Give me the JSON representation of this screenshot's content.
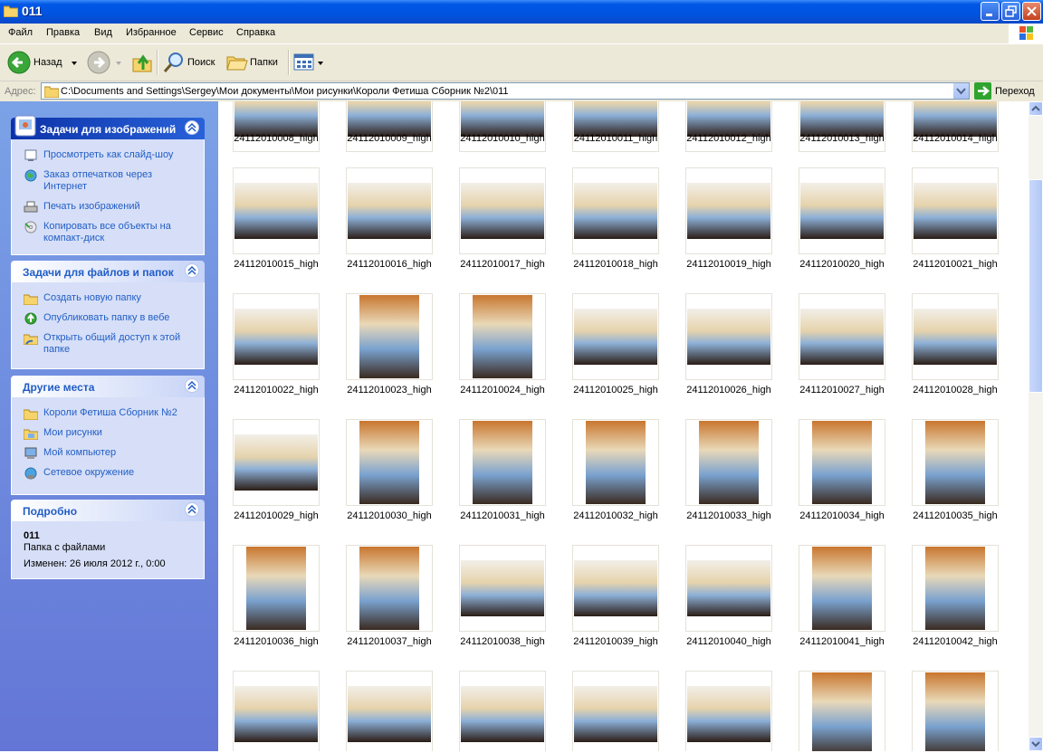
{
  "window": {
    "title": "011"
  },
  "menu": [
    "Файл",
    "Правка",
    "Вид",
    "Избранное",
    "Сервис",
    "Справка"
  ],
  "toolbar": {
    "back": "Назад",
    "search": "Поиск",
    "folders": "Папки"
  },
  "address": {
    "label": "Адрес:",
    "path": "C:\\Documents and Settings\\Sergey\\Мои документы\\Мои рисунки\\Короли Фетиша Сборник №2\\011",
    "go": "Переход"
  },
  "panels": {
    "image_tasks": {
      "title": "Задачи для изображений",
      "items": [
        "Просмотреть как слайд-шоу",
        "Заказ отпечатков через Интернет",
        "Печать изображений",
        "Копировать все объекты на компакт-диск"
      ]
    },
    "file_tasks": {
      "title": "Задачи для файлов и папок",
      "items": [
        "Создать новую папку",
        "Опубликовать папку в вебе",
        "Открыть общий доступ к этой папке"
      ]
    },
    "other_places": {
      "title": "Другие места",
      "items": [
        "Короли Фетиша Сборник №2",
        "Мои рисунки",
        "Мой компьютер",
        "Сетевое окружение"
      ]
    },
    "details": {
      "title": "Подробно",
      "name": "011",
      "type": "Папка с файлами",
      "modified": "Изменен: 26 июля 2012 г., 0:00"
    }
  },
  "files": {
    "row1": [
      "24112010008_high",
      "24112010009_high",
      "24112010010_high",
      "24112010011_high",
      "24112010012_high",
      "24112010013_high",
      "24112010014_high"
    ],
    "row2": [
      "24112010015_high",
      "24112010016_high",
      "24112010017_high",
      "24112010018_high",
      "24112010019_high",
      "24112010020_high",
      "24112010021_high"
    ],
    "row3": [
      "24112010022_high",
      "24112010023_high",
      "24112010024_high",
      "24112010025_high",
      "24112010026_high",
      "24112010027_high",
      "24112010028_high"
    ],
    "row4": [
      "24112010029_high",
      "24112010030_high",
      "24112010031_high",
      "24112010032_high",
      "24112010033_high",
      "24112010034_high",
      "24112010035_high"
    ],
    "row5": [
      "24112010036_high",
      "24112010037_high",
      "24112010038_high",
      "24112010039_high",
      "24112010040_high",
      "24112010041_high",
      "24112010042_high"
    ]
  },
  "icons": [
    "folder-icon",
    "minimize-icon",
    "maximize-icon",
    "close-icon",
    "back-arrow-icon",
    "forward-arrow-icon",
    "up-folder-icon",
    "search-icon",
    "folders-icon",
    "views-icon",
    "go-arrow-icon",
    "windows-flag-icon"
  ]
}
